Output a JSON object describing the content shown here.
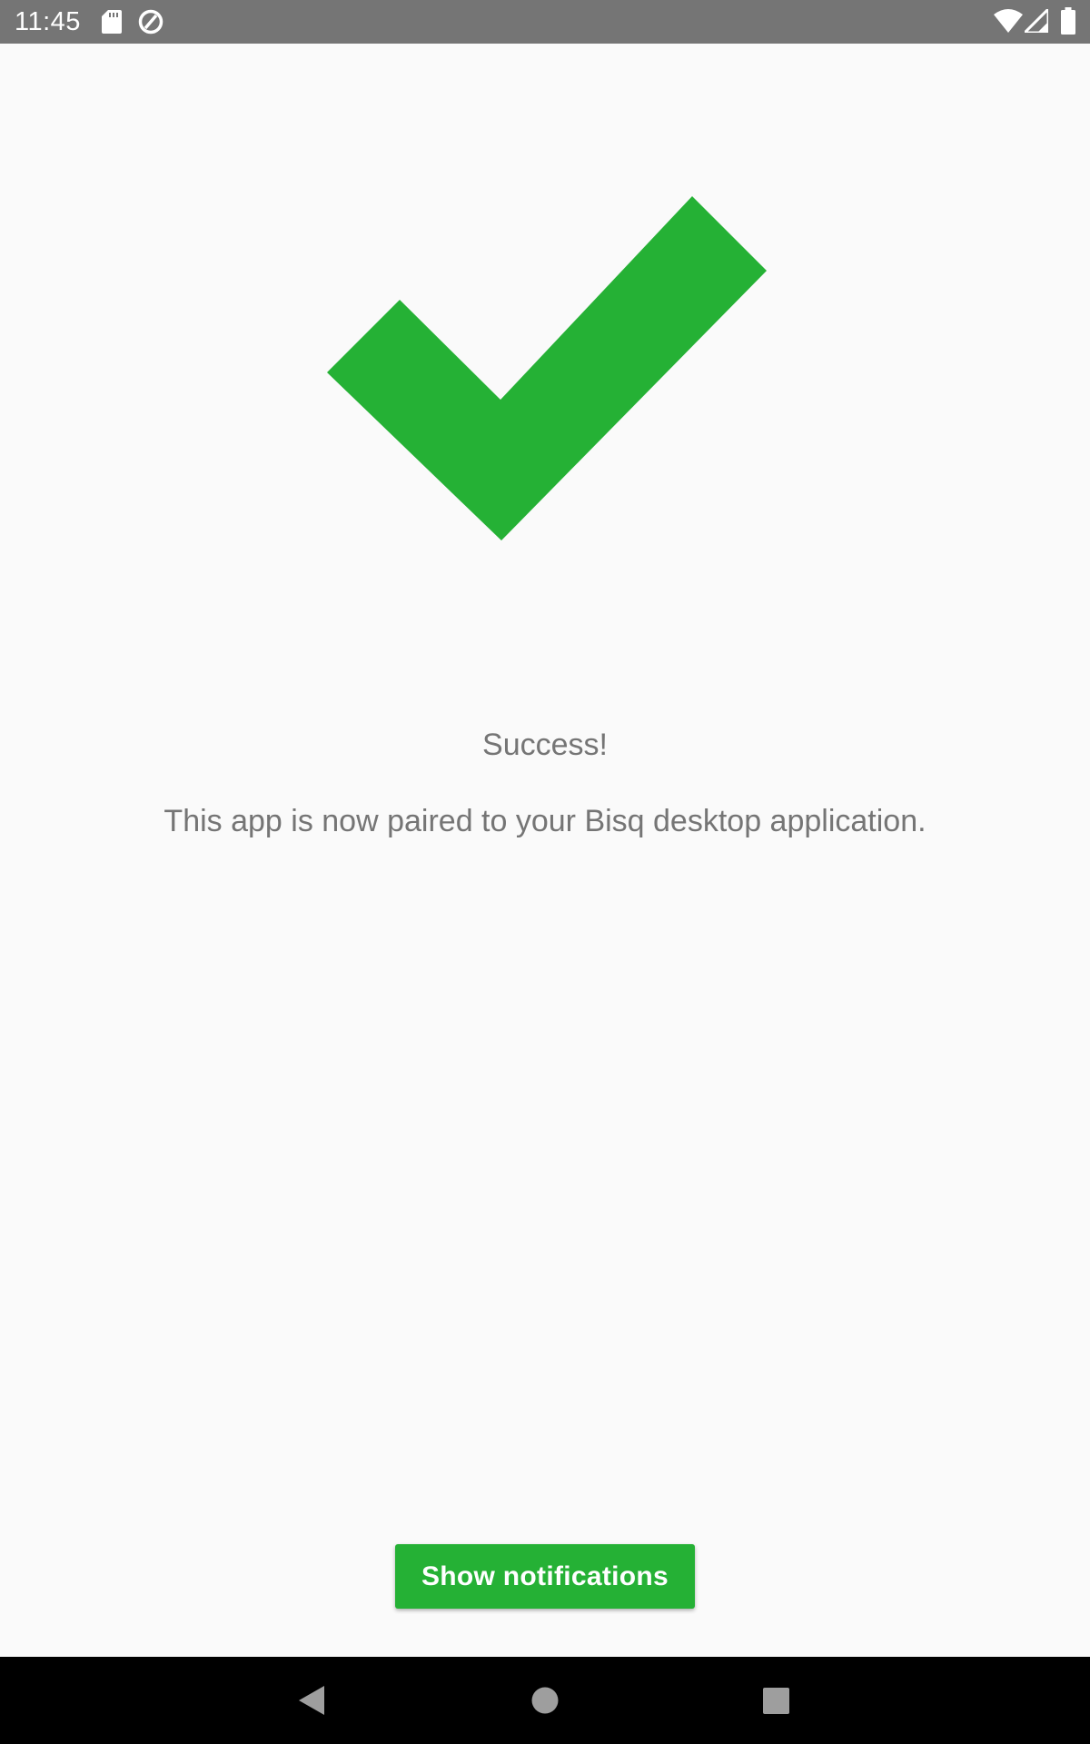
{
  "status_bar": {
    "time": "11:45",
    "icons": [
      "sd-card-icon",
      "data-saver-icon",
      "wifi-icon",
      "cell-signal-icon",
      "battery-icon"
    ]
  },
  "main": {
    "check_icon": "checkmark-icon",
    "title": "Success!",
    "message": "This app is now paired to your Bisq desktop application.",
    "button_label": "Show notifications"
  },
  "nav_bar": {
    "buttons": [
      "back-icon",
      "home-icon",
      "recents-icon"
    ]
  },
  "colors": {
    "accent": "#25b135",
    "status_bar": "#757575",
    "text": "#757575",
    "background": "#fafafa",
    "nav_bar": "#000000"
  }
}
